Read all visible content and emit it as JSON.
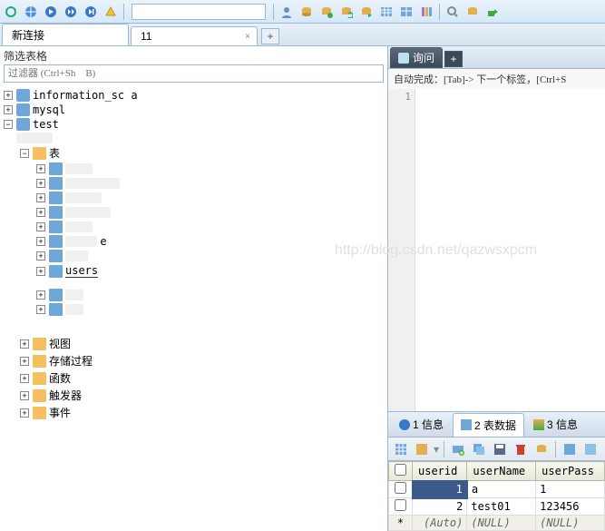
{
  "toolbar": {
    "input_value": ""
  },
  "tabs": [
    {
      "label": "新连接"
    },
    {
      "label": "11"
    }
  ],
  "left": {
    "filter_label": "筛选表格",
    "filter_placeholder": "过滤器 (Ctrl+Sh    B)",
    "tree": {
      "dbs": [
        {
          "name": "information_sc    a"
        },
        {
          "name": "mysql"
        },
        {
          "name": "test"
        }
      ],
      "test_children": {
        "tables_label": "表",
        "users_label": "users",
        "blur_e": "e",
        "views": "视图",
        "procs": "存储过程",
        "funcs": "函数",
        "triggers": "触发器",
        "events": "事件"
      }
    }
  },
  "right": {
    "query_tab": "询问",
    "autocomplete": "自动完成：[Tab]-> 下一个标签，[Ctrl+S",
    "gutter_line": "1",
    "watermark": "http://blog.csdn.net/qazwsxpcm",
    "result_tabs": [
      {
        "label": "1 信息"
      },
      {
        "label": "2 表数据"
      },
      {
        "label": "3 信息"
      }
    ],
    "grid": {
      "headers": [
        "userid",
        "userName",
        "userPass"
      ],
      "rows": [
        {
          "userid": "1",
          "userName": "a",
          "userPass": "1"
        },
        {
          "userid": "2",
          "userName": "test01",
          "userPass": "123456"
        }
      ],
      "newrow": {
        "userid": "(Auto)",
        "userName": "(NULL)",
        "userPass": "(NULL)"
      },
      "newrow_marker": "*"
    }
  }
}
